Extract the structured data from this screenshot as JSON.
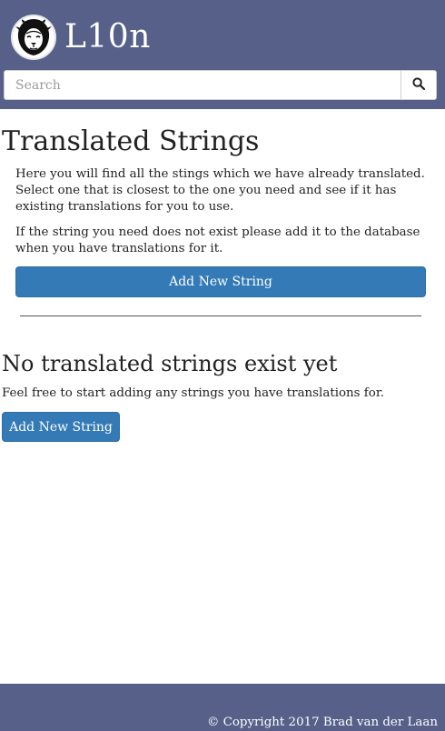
{
  "header": {
    "brand": "L10n",
    "logo_icon": "lion-head-icon",
    "search": {
      "placeholder": "Search",
      "value": ""
    },
    "search_icon": "search-icon",
    "bg_color": "#566089"
  },
  "main": {
    "title": "Translated Strings",
    "intro_1": "Here you will find all the stings which we have already translated. Select one that is closest to the one you need and see if it has existing translations for you to use.",
    "intro_2": "If the string you need does not exist please add it to the database when you have translations for it.",
    "add_button_label": "Add New String",
    "empty": {
      "title": "No translated strings exist yet",
      "text": "Feel free to start adding any strings you have translations for.",
      "add_button_label": "Add New String"
    },
    "accent_color": "#337ab7"
  },
  "footer": {
    "copyright": "© Copyright 2017 Brad van der Laan"
  }
}
